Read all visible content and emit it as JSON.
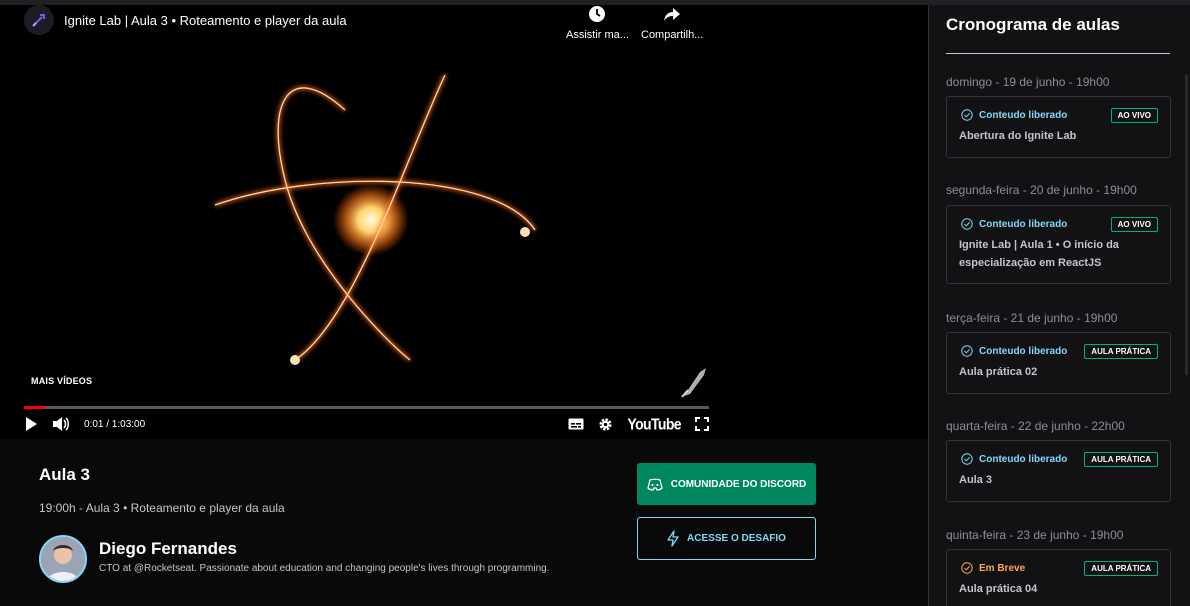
{
  "video": {
    "title": "Ignite Lab | Aula 3 • Roteamento e player da aula",
    "watch_later_label": "Assistir ma...",
    "share_label": "Compartilh...",
    "more_videos_label": "MAIS VÍDEOS",
    "time_label": "0:01 / 1:03:00",
    "progress": 0.03,
    "youtube_label": "YouTube"
  },
  "lesson": {
    "title": "Aula 3",
    "description": "19:00h - Aula 3 • Roteamento e player da aula",
    "teacher_name": "Diego Fernandes",
    "teacher_bio": "CTO at @Rocketseat. Passionate about education and changing people's lives through programming.",
    "discord_button": "COMUNIDADE DO DISCORD",
    "challenge_button": "ACESSE O DESAFIO"
  },
  "sidebar": {
    "title": "Cronograma de aulas",
    "lessons": [
      {
        "date": "domingo - 19 de junho - 19h00",
        "status": "Conteudo liberado",
        "badge": "AO VIVO",
        "title": "Abertura do Ignite Lab"
      },
      {
        "date": "segunda-feira - 20 de junho - 19h00",
        "status": "Conteudo liberado",
        "badge": "AO VIVO",
        "title": "Ignite Lab | Aula 1 • O início da especialização em ReactJS"
      },
      {
        "date": "terça-feira - 21 de junho - 19h00",
        "status": "Conteudo liberado",
        "badge": "AULA PRÁTICA",
        "title": "Aula prática 02"
      },
      {
        "date": "quarta-feira - 22 de junho - 22h00",
        "status": "Conteudo liberado",
        "badge": "AULA PRÁTICA",
        "title": "Aula 3"
      },
      {
        "date": "quinta-feira - 23 de junho - 19h00",
        "status": "Em Breve",
        "badge": "AULA PRÁTICA",
        "title": "Aula prática 04"
      }
    ]
  },
  "colors": {
    "accent_blue": "#81d8f7",
    "green": "#00875f",
    "badge_border": "#00b37e",
    "soon_orange": "#fba94c",
    "sidebar_bg": "#121214"
  },
  "icons": [
    "rocket-icon",
    "clock-icon",
    "share-icon",
    "play-icon",
    "volume-icon",
    "subtitles-icon",
    "gear-icon",
    "fullscreen-icon",
    "discord-icon",
    "lightning-icon",
    "check-circle-icon"
  ]
}
